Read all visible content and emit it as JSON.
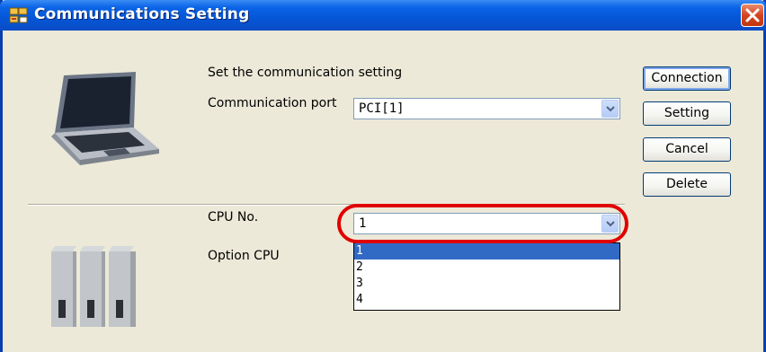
{
  "window": {
    "title": "Communications Setting",
    "app_icon": "network-app-icon",
    "close_icon": "close-icon"
  },
  "communication": {
    "heading": "Set the communication setting",
    "port_label": "Communication port",
    "port_value": "PCI[1]"
  },
  "cpu": {
    "cpu_no_label": "CPU No.",
    "cpu_no_value": "1",
    "option_cpu_label": "Option CPU",
    "dropdown_options": [
      "1",
      "2",
      "3",
      "4"
    ],
    "selected_option": "1"
  },
  "buttons": {
    "connection": "Connection",
    "setting": "Setting",
    "cancel": "Cancel",
    "delete": "Delete"
  },
  "colors": {
    "title_bar": "#0556d6",
    "selection": "#316ac5",
    "highlight_ring": "#e00000"
  }
}
